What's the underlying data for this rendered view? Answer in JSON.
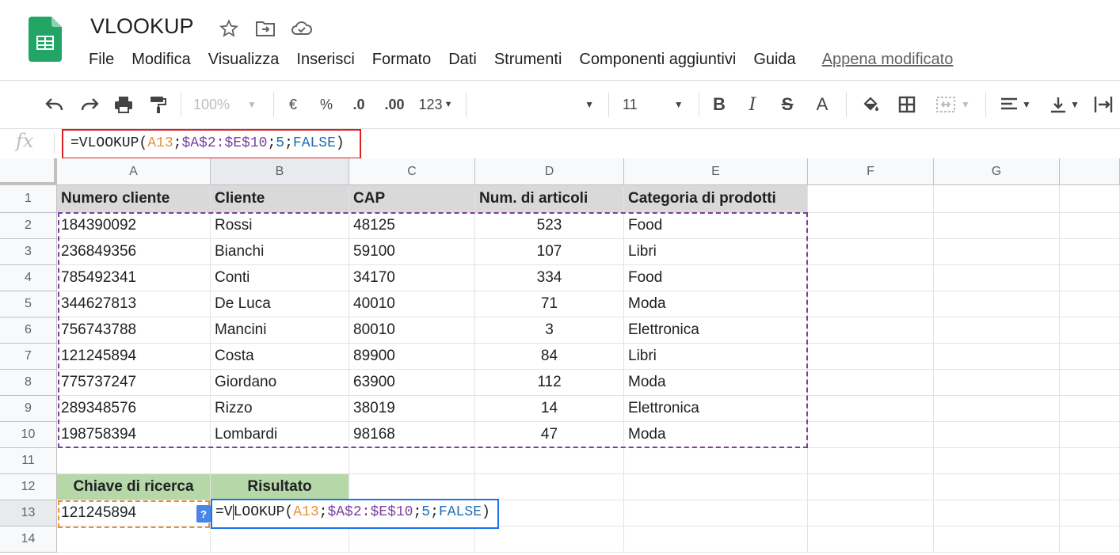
{
  "doc": {
    "title": "VLOOKUP"
  },
  "menu": [
    "File",
    "Modifica",
    "Visualizza",
    "Inserisci",
    "Formato",
    "Dati",
    "Strumenti",
    "Componenti aggiuntivi",
    "Guida"
  ],
  "last_edit": "Appena modificato",
  "toolbar": {
    "zoom": "100%",
    "currency": "€",
    "percent": "%",
    "dec_less": ".0",
    "dec_more": ".00",
    "more_formats": "123",
    "font_size": "11",
    "bold": "B",
    "italic": "I",
    "strike": "S",
    "text_color": "A"
  },
  "formula_bar": {
    "fx": "fx",
    "parts": [
      "=VLOOKUP(",
      "A13",
      ";",
      "$A$2:$E$10",
      ";",
      "5",
      ";",
      "FALSE",
      ")"
    ]
  },
  "columns": [
    "A",
    "B",
    "C",
    "D",
    "E",
    "F",
    "G"
  ],
  "rows": [
    "1",
    "2",
    "3",
    "4",
    "5",
    "6",
    "7",
    "8",
    "9",
    "10",
    "11",
    "12",
    "13",
    "14"
  ],
  "table": {
    "headers": [
      "Numero cliente",
      "Cliente",
      "CAP",
      "Num. di articoli",
      "Categoria di prodotti"
    ],
    "data": [
      [
        "184390092",
        "Rossi",
        "48125",
        "523",
        "Food"
      ],
      [
        "236849356",
        "Bianchi",
        "59100",
        "107",
        "Libri"
      ],
      [
        "785492341",
        "Conti",
        "34170",
        "334",
        "Food"
      ],
      [
        "344627813",
        "De Luca",
        "40010",
        "71",
        "Moda"
      ],
      [
        "756743788",
        "Mancini",
        "80010",
        "3",
        "Elettronica"
      ],
      [
        "121245894",
        "Costa",
        "89900",
        "84",
        "Libri"
      ],
      [
        "775737247",
        "Giordano",
        "63900",
        "112",
        "Moda"
      ],
      [
        "289348576",
        "Rizzo",
        "38019",
        "14",
        "Elettronica"
      ],
      [
        "198758394",
        "Lombardi",
        "98168",
        "47",
        "Moda"
      ]
    ]
  },
  "lookup": {
    "key_label": "Chiave di ricerca",
    "result_label": "Risultato",
    "key_value": "121245894",
    "help": "?",
    "edit_parts": [
      "=V",
      "LOOKUP(",
      "A13",
      ";",
      "$A$2:$E$10",
      ";",
      "5",
      ";",
      "FALSE",
      ")"
    ]
  },
  "colors": {
    "range_dash": "#7b3f9e",
    "key_dash": "#e69138",
    "formula_outline": "#e02020",
    "edit_outline": "#1a73e8",
    "green_header": "#b6d7a8"
  }
}
